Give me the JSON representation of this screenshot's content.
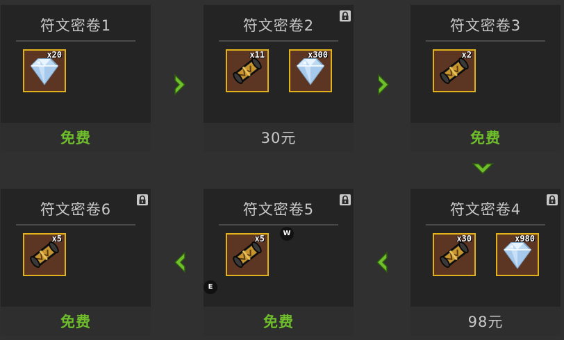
{
  "panels": {
    "p1": {
      "title": "符文密卷1",
      "price": "免费",
      "items": [
        {
          "icon": "diamond-icon",
          "qty": "x20"
        }
      ]
    },
    "p2": {
      "title": "符文密卷2",
      "price": "30元",
      "locked": true,
      "items": [
        {
          "icon": "scroll-icon",
          "qty": "x11"
        },
        {
          "icon": "diamond-icon",
          "qty": "x300"
        }
      ]
    },
    "p3": {
      "title": "符文密卷3",
      "price": "免费",
      "items": [
        {
          "icon": "scroll-icon",
          "qty": "x2"
        }
      ]
    },
    "p4": {
      "title": "符文密卷4",
      "price": "98元",
      "locked": true,
      "items": [
        {
          "icon": "scroll-icon",
          "qty": "x30"
        },
        {
          "icon": "diamond-icon",
          "qty": "x980"
        }
      ]
    },
    "p5": {
      "title": "符文密卷5",
      "price": "免费",
      "locked": true,
      "items": [
        {
          "icon": "scroll-icon",
          "qty": "x5"
        }
      ]
    },
    "p6": {
      "title": "符文密卷6",
      "price": "免费",
      "locked": true,
      "items": [
        {
          "icon": "scroll-icon",
          "qty": "x5"
        }
      ]
    }
  },
  "markers": {
    "w": "W",
    "e": "E"
  },
  "colors": {
    "free": "#6fbe2c",
    "price": "#c9c9c9",
    "item_border": "#e2b21c",
    "arrow": "#6fbe2c"
  }
}
